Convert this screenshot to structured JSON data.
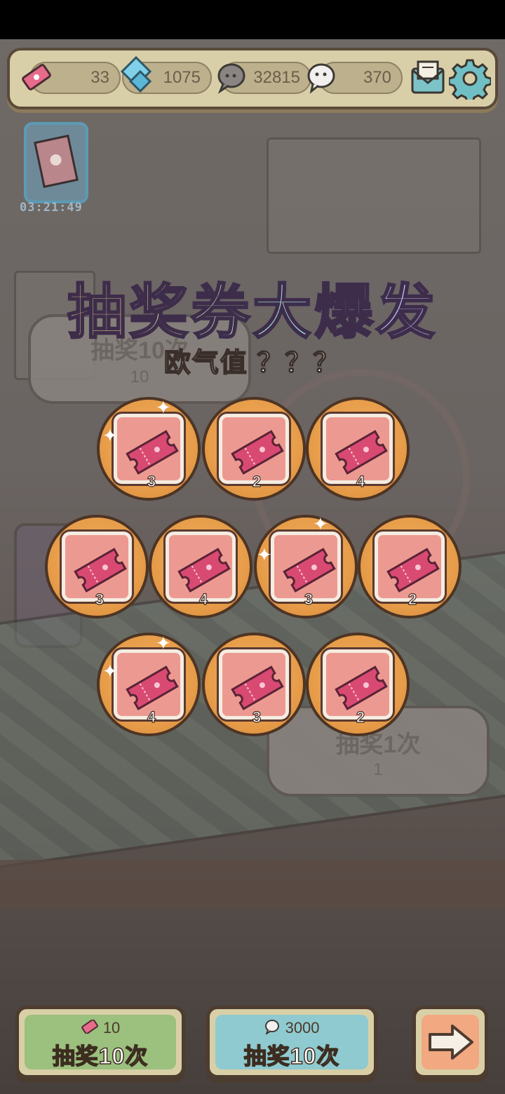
{
  "topbar": {
    "lottery_tickets": "33",
    "second_currency": "1075",
    "coins": "32815",
    "ghost_currency": "370",
    "mail_icon": "mail-icon",
    "settings_icon": "gear-icon"
  },
  "side_event": {
    "timer": "03:21:49"
  },
  "background_buttons": {
    "draw_ten": {
      "label": "抽奖10次",
      "cost": "10"
    },
    "draw_one": {
      "label": "抽奖1次",
      "cost": "1"
    }
  },
  "overlay": {
    "title": "抽奖券大爆发",
    "luck_label": "欧气值 ？？？",
    "rewards": [
      {
        "item": "lottery-ticket",
        "qty": "3"
      },
      {
        "item": "lottery-ticket",
        "qty": "2"
      },
      {
        "item": "lottery-ticket",
        "qty": "4"
      },
      {
        "item": "lottery-ticket",
        "qty": "3"
      },
      {
        "item": "lottery-ticket",
        "qty": "4"
      },
      {
        "item": "lottery-ticket",
        "qty": "3"
      },
      {
        "item": "lottery-ticket",
        "qty": "2"
      },
      {
        "item": "lottery-ticket",
        "qty": "4"
      },
      {
        "item": "lottery-ticket",
        "qty": "3"
      },
      {
        "item": "lottery-ticket",
        "qty": "2"
      }
    ]
  },
  "bottom": {
    "ticket_draw": {
      "cost": "10",
      "label": "抽奖10次",
      "color": "#9cc07e"
    },
    "coin_draw": {
      "cost": "3000",
      "label": "抽奖10次",
      "color": "#8fcad0"
    },
    "next_button": {
      "icon": "arrow-right-icon",
      "color": "#f2a880"
    }
  }
}
